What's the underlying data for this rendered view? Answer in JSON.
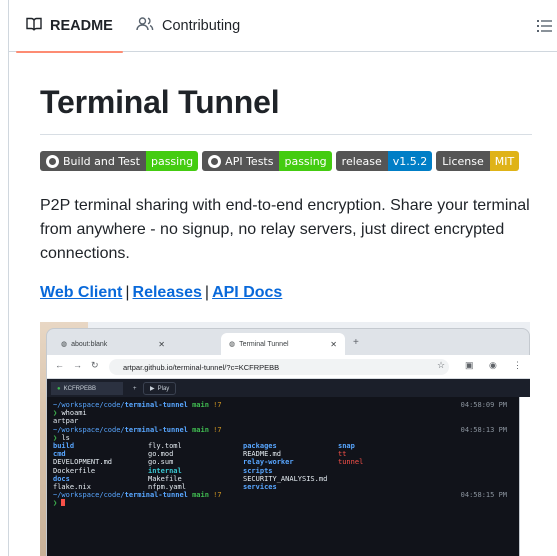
{
  "tabs": {
    "readme": "README",
    "contributing": "Contributing"
  },
  "readme": {
    "title": "Terminal Tunnel",
    "badges": [
      {
        "label": "Build and Test",
        "value": "passing",
        "color": "#4c1"
      },
      {
        "label": "API Tests",
        "value": "passing",
        "color": "#4c1"
      },
      {
        "label": "release",
        "value": "v1.5.2",
        "color": "#007ec6"
      },
      {
        "label": "License",
        "value": "MIT",
        "color": "#dfb317"
      }
    ],
    "description": "P2P terminal sharing with end-to-end encryption. Share your terminal from anywhere - no signup, no relay servers, just direct encrypted connections.",
    "links": [
      "Web Client",
      "Releases",
      "API Docs"
    ],
    "separator": "|"
  },
  "screenshot": {
    "tab1": "about:blank",
    "tab2": "Terminal Tunnel",
    "url": "artpar.github.io/terminal-tunnel/?c=KCFRPEBB",
    "session_tab": "KCFRPEBB",
    "play": "Play",
    "lines": {
      "path1": "~/workspace/code/",
      "repo": "terminal-tunnel",
      "branch": "main",
      "changes": "!7",
      "cmd1": "whoami",
      "out1": "artpar",
      "cmd2": "ls",
      "time1": "04:58:09 PM",
      "time2": "04:58:13 PM",
      "time3": "04:58:15 PM"
    },
    "ls": [
      [
        "build",
        "fly.toml",
        "packages",
        "snap"
      ],
      [
        "cmd",
        "go.mod",
        "README.md",
        "tt"
      ],
      [
        "DEVELOPMENT.md",
        "go.sum",
        "relay-worker",
        "tunnel"
      ],
      [
        "Dockerfile",
        "internal",
        "scripts",
        ""
      ],
      [
        "docs",
        "Makefile",
        "SECURITY_ANALYSIS.md",
        ""
      ],
      [
        "flake.nix",
        "nfpm.yaml",
        "services",
        ""
      ]
    ]
  }
}
